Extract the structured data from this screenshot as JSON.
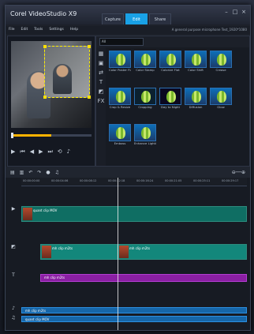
{
  "app": {
    "title": "Corel VideoStudio X9"
  },
  "tabs": [
    {
      "label": "Capture"
    },
    {
      "label": "Edit"
    },
    {
      "label": "Share"
    }
  ],
  "menu": [
    "File",
    "Edit",
    "Tools",
    "Settings",
    "Help"
  ],
  "status": "A general purpose microphone Test_1920*1080",
  "library": {
    "dropdown": "All",
    "items": [
      {
        "label": "Color Poster Flat"
      },
      {
        "label": "Color Stamp"
      },
      {
        "label": "Colorize Flat"
      },
      {
        "label": "Color Shift"
      },
      {
        "label": "Crease"
      },
      {
        "label": "Crop & Resize"
      },
      {
        "label": "Cropping"
      },
      {
        "label": "Day to Night"
      },
      {
        "label": "Diffusion"
      },
      {
        "label": "Glow"
      },
      {
        "label": "Emboss"
      },
      {
        "label": "Enhance Lighting"
      }
    ]
  },
  "timeline": {
    "ruler": [
      "00:00:00:00",
      "00:00:04:06",
      "00:00:08:12",
      "00:00:12:18",
      "00:00:16:24",
      "00:00:21:05",
      "00:00:25:11",
      "00:00:29:17"
    ],
    "tracks": [
      {
        "label": "quant clip MOV"
      },
      {
        "label": "mh clip m2ts"
      },
      {
        "label": "mh clip m2ts"
      },
      {
        "label": "mh clip m2ts"
      },
      {
        "label": "mh clip m2ts"
      },
      {
        "label": "quant clip MOV"
      }
    ]
  },
  "colors": {
    "accent": "#19a1e6",
    "clip_teal": "#13877b",
    "clip_purple": "#8b1fa3",
    "clip_blue": "#1666a8"
  }
}
